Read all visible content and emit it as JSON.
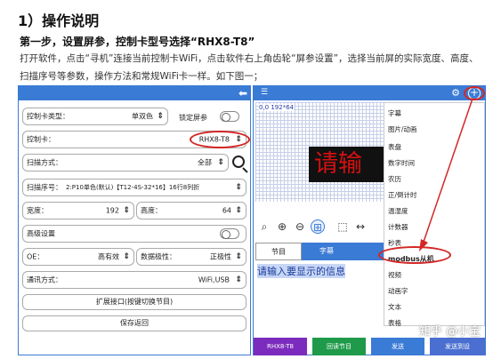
{
  "article": {
    "heading": "1）操作说明",
    "step_title": "第一步，设置屏参，控制卡型号选择“RHX8-T8”",
    "paragraph": "打开软件，点击“寻机”连接当前控制卡WiFi，点击软件右上角齿轮“屏参设置”，选择当前屏的实际宽度、高度、扫描序号等参数，操作方法和常规WiFi卡一样。如下图一；"
  },
  "left_phone": {
    "card_type_label": "控制卡类型：",
    "card_type_value": "单双色",
    "lock_label": "锁定屏参",
    "card_label": "控制卡：",
    "card_value": "RHX8-T8",
    "scan_mode_label": "扫描方式：",
    "scan_mode_value": "全部",
    "scan_seq_label": "扫描序号：",
    "scan_seq_value": "2:P10单色(默认)【T12-4S-32*16】16行8列折",
    "width_label": "宽度：",
    "width_value": "192",
    "height_label": "高度：",
    "height_value": "64",
    "advanced_label": "高级设置",
    "oe_label": "OE：",
    "oe_value": "高有效",
    "data_polarity_label": "数据极性：",
    "data_polarity_value": "正极性",
    "comm_label": "通讯方式：",
    "comm_value": "WiFi,USB",
    "expand_button": "扩展接口(按键切换节目)",
    "save_button": "保存返回"
  },
  "right_phone": {
    "coords": "0,0 192*64",
    "led_text": "请输",
    "tab_program": "节目",
    "tab_subtitle": "字幕",
    "input_text": "请输入要显示的信息",
    "bottom_bar": [
      "RHX8-T8",
      "回读节目",
      "发送",
      "发送到设"
    ],
    "bottom_colors": [
      "#7b2bbd",
      "#1e9a4a",
      "#3a7bd5",
      "#4a6fd1"
    ],
    "menu_items": [
      "字幕",
      "图片/动画",
      "表盘",
      "数字时间",
      "农历",
      "正/倒计时",
      "温湿度",
      "计数器",
      "秒表",
      "modbus从机",
      "视频",
      "动画字",
      "文本",
      "表格"
    ]
  },
  "watermark": "知乎 @小宝"
}
